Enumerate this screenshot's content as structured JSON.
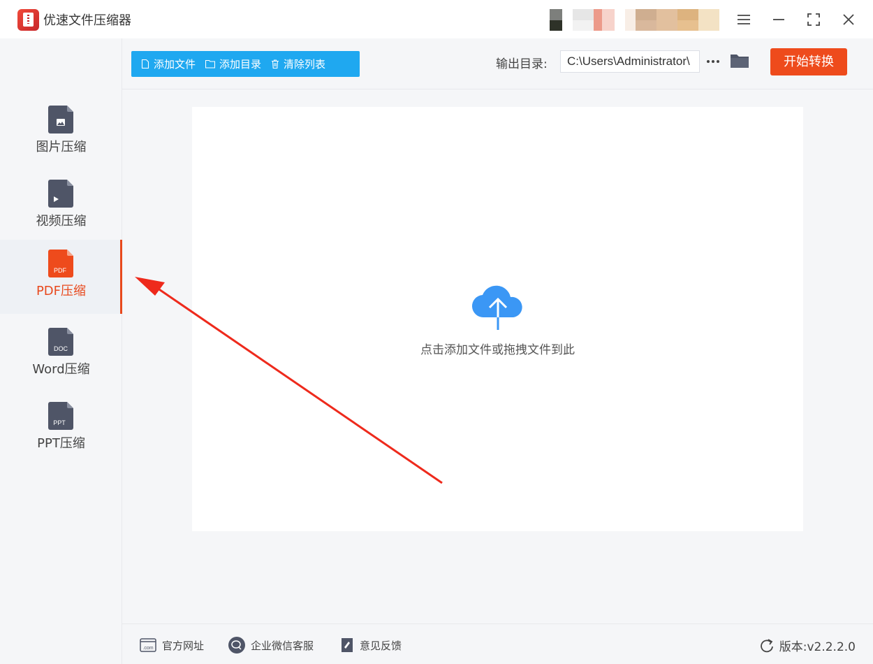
{
  "app": {
    "title": "优速文件压缩器"
  },
  "sidebar": {
    "items": [
      {
        "label": "图片压缩",
        "icon": "image-file-icon",
        "active": false
      },
      {
        "label": "视频压缩",
        "icon": "video-file-icon",
        "active": false
      },
      {
        "label": "PDF压缩",
        "icon": "pdf-file-icon",
        "tag": "PDF",
        "active": true
      },
      {
        "label": "Word压缩",
        "icon": "doc-file-icon",
        "tag": "DOC",
        "active": false
      },
      {
        "label": "PPT压缩",
        "icon": "ppt-file-icon",
        "tag": "PPT",
        "active": false
      }
    ]
  },
  "toolbar": {
    "add_file": "添加文件",
    "add_dir": "添加目录",
    "clear_list": "清除列表",
    "output_label": "输出目录:",
    "output_path": "C:\\Users\\Administrator\\",
    "start": "开始转换"
  },
  "dropzone": {
    "hint": "点击添加文件或拖拽文件到此"
  },
  "footer": {
    "website": "官方网址",
    "wechat": "企业微信客服",
    "feedback": "意见反馈",
    "version": "版本:v2.2.2.0"
  },
  "colors": {
    "accent": "#e8491d",
    "primary": "#1fa8f0",
    "start": "#ee4b1c",
    "icon_gray": "#4f5567",
    "cloud": "#3b97f5"
  }
}
